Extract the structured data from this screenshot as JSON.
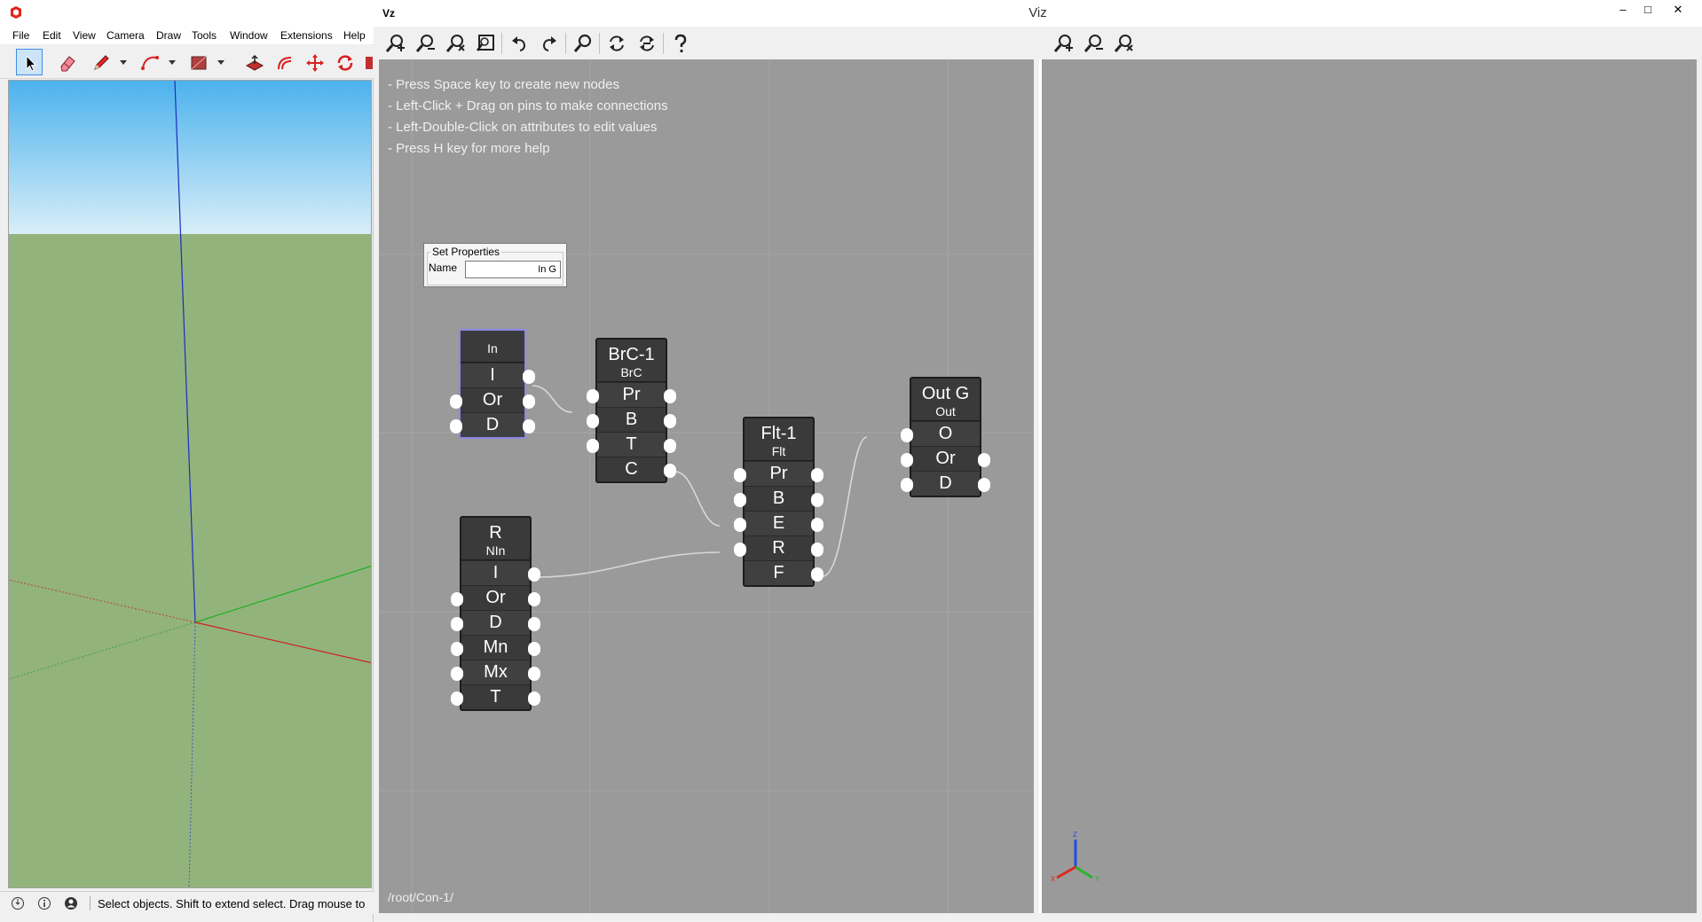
{
  "left_app": {
    "menu": [
      "File",
      "Edit",
      "View",
      "Camera",
      "Draw",
      "Tools",
      "Window",
      "Extensions",
      "Help"
    ],
    "status_text": "Select objects. Shift to extend select. Drag mouse to"
  },
  "viz": {
    "title": "Viz",
    "app_icon": "Vz",
    "window_controls": {
      "minimize": "–",
      "maximize": "□",
      "close": "✕"
    },
    "help_lines": [
      "- Press Space key to create new nodes",
      "- Left-Click + Drag on pins to make connections",
      "- Left-Double-Click on attributes to edit values",
      "- Press H key for more help"
    ],
    "path": "/root/Con-1/",
    "set_properties": {
      "legend": "Set Properties",
      "name_label": "Name",
      "name_value": "In G"
    },
    "nodes": {
      "in": {
        "type": "In",
        "attrs": [
          "I",
          "Or",
          "D"
        ]
      },
      "brc": {
        "title": "BrC-1",
        "type": "BrC",
        "attrs": [
          "Pr",
          "B",
          "T",
          "C"
        ]
      },
      "flt": {
        "title": "Flt-1",
        "type": "Flt",
        "attrs": [
          "Pr",
          "B",
          "E",
          "R",
          "F"
        ]
      },
      "out": {
        "title": "Out G",
        "type": "Out",
        "attrs": [
          "O",
          "Or",
          "D"
        ]
      },
      "r": {
        "title": "R",
        "type": "NIn",
        "attrs": [
          "I",
          "Or",
          "D",
          "Mn",
          "Mx",
          "T"
        ]
      }
    },
    "axis_labels": {
      "x": "X",
      "y": "Y",
      "z": "Z"
    }
  },
  "colors": {
    "sky": "#5cb8f0",
    "ground": "#92b37c",
    "graph_bg": "#9a9a9a",
    "node_bg": "#3a3a3a",
    "selected_border": "#8e86e8",
    "axis_red": "#e0281e",
    "axis_green": "#28b428",
    "axis_blue": "#2050e0"
  }
}
